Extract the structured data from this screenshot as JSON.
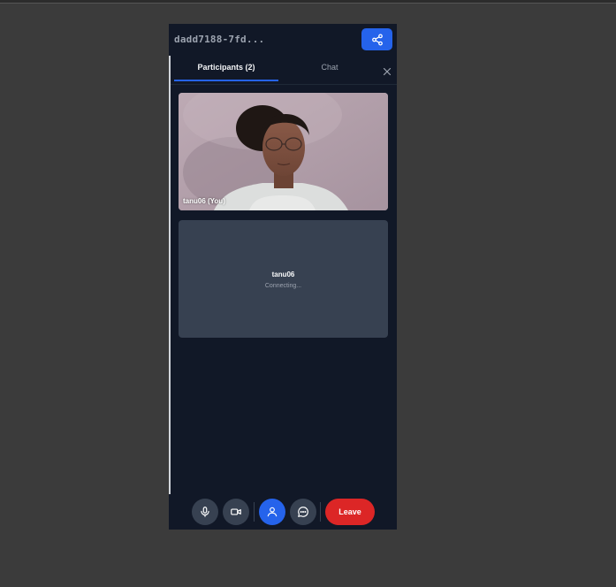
{
  "header": {
    "room_id": "dadd7188-7fd...",
    "share_icon": "share-icon"
  },
  "tabs": [
    {
      "label": "Participants (2)",
      "active": true
    },
    {
      "label": "Chat",
      "active": false
    }
  ],
  "close_icon": "close-icon",
  "participants": [
    {
      "label": "tanu06 (You)",
      "video": true
    },
    {
      "name": "tanu06",
      "status": "Connecting...",
      "video": false
    }
  ],
  "toolbar": {
    "leave_label": "Leave",
    "icons": [
      "microphone-icon",
      "camera-icon",
      "participants-icon",
      "chat-icon"
    ]
  },
  "colors": {
    "accent": "#2563eb",
    "leave": "#dc2626",
    "panel": "#111827",
    "tile": "#374151"
  }
}
